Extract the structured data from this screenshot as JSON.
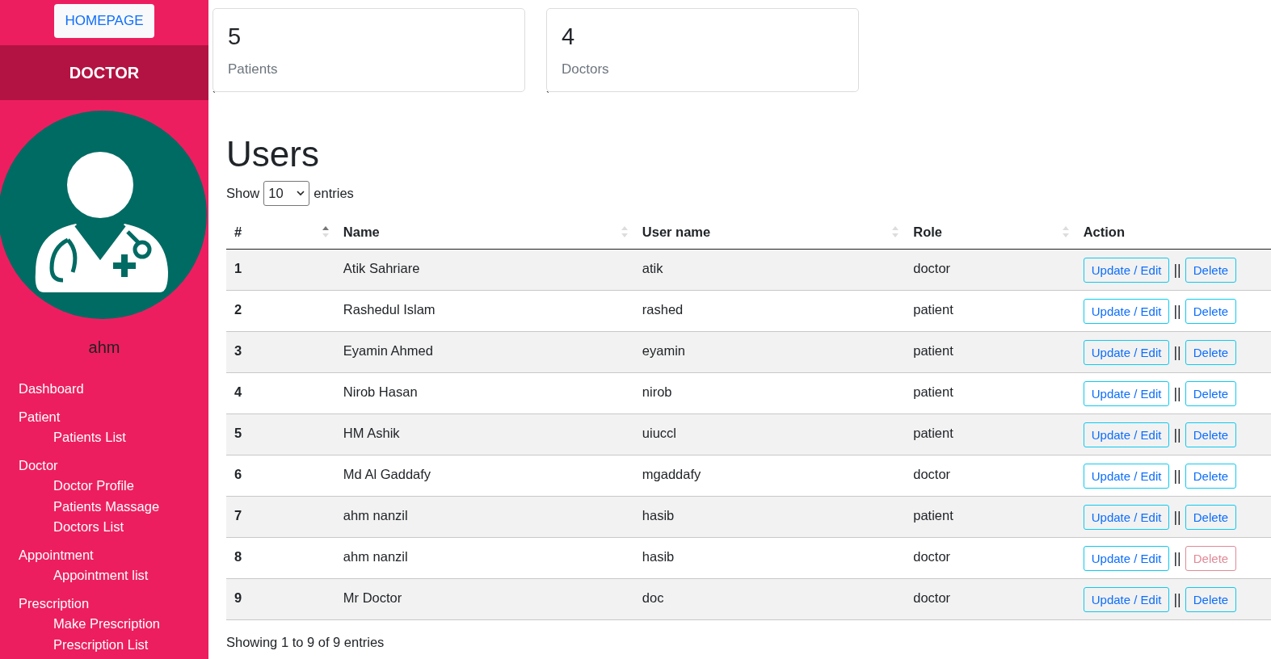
{
  "sidebar": {
    "homepage_button": "HOMEPAGE",
    "role_header": "DOCTOR",
    "user_name": "ahm",
    "items": [
      {
        "label": "Dashboard"
      },
      {
        "label": "Patient",
        "children": [
          {
            "label": "Patients List"
          }
        ]
      },
      {
        "label": "Doctor",
        "children": [
          {
            "label": "Doctor Profile"
          },
          {
            "label": "Patients Massage"
          },
          {
            "label": "Doctors List"
          }
        ]
      },
      {
        "label": "Appointment",
        "children": [
          {
            "label": "Appointment list"
          }
        ]
      },
      {
        "label": "Prescription",
        "children": [
          {
            "label": "Make Prescription"
          },
          {
            "label": "Prescription List"
          }
        ]
      }
    ]
  },
  "stat_cards": [
    {
      "count": "5",
      "label": "Patients",
      "note": "`"
    },
    {
      "count": "4",
      "label": "Doctors",
      "note": "`"
    }
  ],
  "users": {
    "title": "Users",
    "length_menu": {
      "prefix": "Show",
      "value": "10",
      "suffix": "entries"
    },
    "table": {
      "columns": [
        {
          "label": "#",
          "sortable": true,
          "sorted": true
        },
        {
          "label": "Name",
          "sortable": true,
          "sorted": false
        },
        {
          "label": "User name",
          "sortable": true,
          "sorted": false
        },
        {
          "label": "Role",
          "sortable": true,
          "sorted": false
        },
        {
          "label": "Action",
          "sortable": false
        }
      ],
      "rows": [
        {
          "id": "1",
          "name": "Atik Sahriare",
          "username": "atik",
          "role": "doctor",
          "edit": "Update / Edit",
          "separator": "||",
          "delete": "Delete",
          "delete_hovered": false
        },
        {
          "id": "2",
          "name": "Rashedul Islam",
          "username": "rashed",
          "role": "patient",
          "edit": "Update / Edit",
          "separator": "||",
          "delete": "Delete",
          "delete_hovered": false
        },
        {
          "id": "3",
          "name": "Eyamin Ahmed",
          "username": "eyamin",
          "role": "patient",
          "edit": "Update / Edit",
          "separator": "||",
          "delete": "Delete",
          "delete_hovered": false
        },
        {
          "id": "4",
          "name": "Nirob Hasan",
          "username": "nirob",
          "role": "patient",
          "edit": "Update / Edit",
          "separator": "||",
          "delete": "Delete",
          "delete_hovered": false
        },
        {
          "id": "5",
          "name": "HM Ashik",
          "username": "uiuccl",
          "role": "patient",
          "edit": "Update / Edit",
          "separator": "||",
          "delete": "Delete",
          "delete_hovered": false
        },
        {
          "id": "6",
          "name": "Md Al Gaddafy",
          "username": "mgaddafy",
          "role": "doctor",
          "edit": "Update / Edit",
          "separator": "||",
          "delete": "Delete",
          "delete_hovered": false
        },
        {
          "id": "7",
          "name": "ahm nanzil",
          "username": "hasib",
          "role": "patient",
          "edit": "Update / Edit",
          "separator": "||",
          "delete": "Delete",
          "delete_hovered": false
        },
        {
          "id": "8",
          "name": "ahm nanzil",
          "username": "hasib",
          "role": "doctor",
          "edit": "Update / Edit",
          "separator": "||",
          "delete": "Delete",
          "delete_hovered": true
        },
        {
          "id": "9",
          "name": "Mr Doctor",
          "username": "doc",
          "role": "doctor",
          "edit": "Update / Edit",
          "separator": "||",
          "delete": "Delete",
          "delete_hovered": false
        }
      ]
    },
    "info": "Showing 1 to 9 of 9 entries"
  }
}
